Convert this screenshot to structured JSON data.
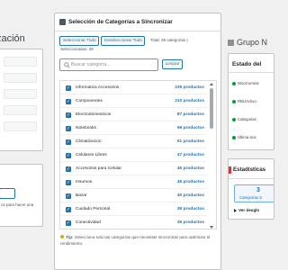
{
  "left": {
    "heading_fragment": "zación",
    "hint_fragment": "os para hacer una"
  },
  "main": {
    "title": "Selección de Categorías a Sincronizar",
    "select_all_label": "Seleccionar Todo",
    "deselect_all_label": "Deseleccionar Todo",
    "total_label": "Total: 39 categorías |",
    "selected_label": "Seleccionadas: 39",
    "search_placeholder": "Buscar categoría...",
    "clear_label": "Limpiar",
    "categories": [
      {
        "name": "Informatica Accesorios",
        "count": "239 productos"
      },
      {
        "name": "Componentes",
        "count": "210 productos"
      },
      {
        "name": "Electrodomesticos",
        "count": "87 productos"
      },
      {
        "name": "Notebooks",
        "count": "59 productos"
      },
      {
        "name": "Climatizacion",
        "count": "51 productos"
      },
      {
        "name": "Celulares Libres",
        "count": "47 productos"
      },
      {
        "name": "Accesorios para Celular",
        "count": "45 productos"
      },
      {
        "name": "Insumos",
        "count": "45 productos"
      },
      {
        "name": "Bazar",
        "count": "40 productos"
      },
      {
        "name": "Cuidado Personal",
        "count": "39 productos"
      },
      {
        "name": "Conectividad",
        "count": "35 productos"
      }
    ],
    "tip_strong": "Tip:",
    "tip_text": "Selecciona solo las categorías que necesitas sincronizar para optimizar el rendimiento."
  },
  "right": {
    "heading_fragment": "Grupo N",
    "status_title": "Estado del",
    "status_items": [
      "WooComme",
      "RBUActivo",
      "Categorias",
      "Última sinc"
    ],
    "stats_title": "Estadísticas",
    "stats_number": "3",
    "stats_label": "Categorías S",
    "stats_toggle_label": "Ver desglo"
  }
}
